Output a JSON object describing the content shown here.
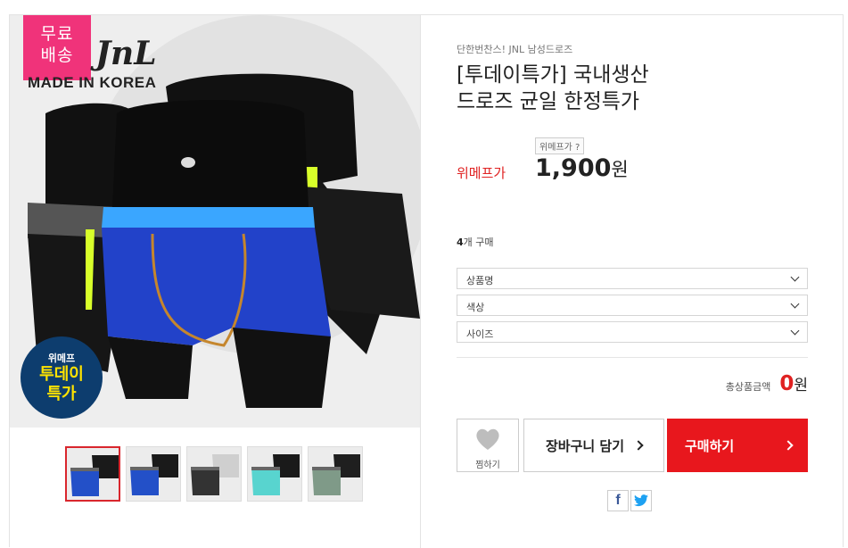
{
  "product_image": {
    "free_shipping_badge": [
      "무료",
      "배송"
    ],
    "brand_logo_text": "JnL",
    "made_in_text": "MADE IN KOREA",
    "today_badge_small": "위메프",
    "today_badge_line1": "투데이",
    "today_badge_line2": "특가"
  },
  "thumbnails": [
    {
      "colors": [
        "#1a1a1a",
        "#2350c8"
      ],
      "active": true
    },
    {
      "colors": [
        "#1a1a1a",
        "#2350c8"
      ],
      "active": false
    },
    {
      "colors": [
        "#cfcfcf",
        "#333333"
      ],
      "active": false
    },
    {
      "colors": [
        "#1a1a1a",
        "#58d4cf"
      ],
      "active": false
    },
    {
      "colors": [
        "#1f1f1f",
        "#7f9a88"
      ],
      "active": false
    }
  ],
  "product": {
    "shop_name": "단한번찬스! JNL 남성드로즈",
    "title_line1": "[투데이특가] 국내생산",
    "title_line2": "드로즈 균일 한정특가",
    "price_note": "위메프가 ?",
    "price_label": "위메프가",
    "price_value": "1,900",
    "price_unit": "원",
    "purchase_count": "4",
    "purchase_suffix": "개 구매"
  },
  "options": [
    {
      "label": "상품명"
    },
    {
      "label": "색상"
    },
    {
      "label": "사이즈"
    }
  ],
  "total": {
    "label": "총상품금액",
    "amount": "0",
    "unit": "원"
  },
  "actions": {
    "wish_label": "찜하기",
    "cart_label": "장바구니 담기",
    "buy_label": "구매하기"
  },
  "social": {
    "facebook": "f",
    "twitter": "t"
  },
  "colors": {
    "accent_red": "#e8171d",
    "price_red": "#e02222",
    "free_ship_pink": "#f0337a",
    "badge_navy": "#0d3d6e"
  }
}
